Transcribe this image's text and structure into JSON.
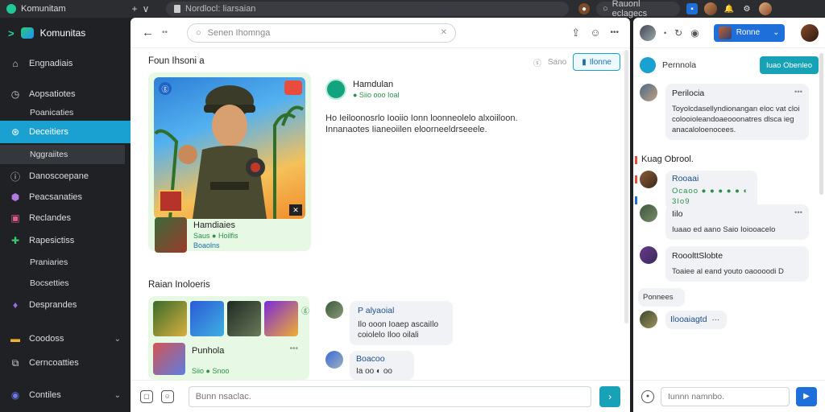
{
  "browser": {
    "tab_title": "Komunitam",
    "new_tab": "+",
    "tab_menu": "∨",
    "address": "Nordlocl: liarsaian",
    "search_box": "Rauonl eclagecs"
  },
  "sidebar": {
    "brand": "Komunitas",
    "items": [
      {
        "label": "Engnadiais"
      },
      {
        "label": "Aopsatiotes"
      },
      {
        "label": "Poanicaties"
      },
      {
        "label": "Deceitiers"
      },
      {
        "label": "Nggraiites"
      },
      {
        "label": "Danoscoepane"
      },
      {
        "label": "Peacsanaties"
      },
      {
        "label": "Reclandes"
      },
      {
        "label": "Rapesictiss"
      },
      {
        "label": "Praniaries"
      },
      {
        "label": "Bocsetties"
      },
      {
        "label": "Desprandes"
      },
      {
        "label": "Coodoss"
      },
      {
        "label": "Cerncoatties"
      },
      {
        "label": "Contiles"
      }
    ]
  },
  "main": {
    "search_placeholder": "Senen Ihomnga",
    "search_clear": "✕",
    "section_featured": "Foun Ihsoni a",
    "follow_label": "Sano",
    "follow_button": "Ilonne",
    "featured_mini": {
      "title": "Hamdiaies",
      "stats": "Saus ● Hoilfis",
      "badge": "Boaolns"
    },
    "post": {
      "author": "Hamdulan",
      "sub": "● Siio ooo Ioal",
      "body_line1": "Ho Ieiloonosrlo Iooiio Ionn loonneolelo alxoiiloon.",
      "body_line2": "Innanaotes Iianeoiilen eloorneeldrseeele."
    },
    "section_related": "Raian Inoloeris",
    "related": {
      "title": "Punhola",
      "stats": "Siio ● Snoo"
    },
    "comments": [
      {
        "name": "P alyaoial",
        "text_1": "Ilo ooon Ioaep ascaiIlo",
        "text_2": "coiolelo Iloo oilali"
      },
      {
        "name": "Boacoo",
        "text_1": "Ia oo ◐ oo"
      }
    ],
    "compose_placeholder": "Bunn nsaclac."
  },
  "chat": {
    "pill_label": "Ronne",
    "row_label": "Pernnola",
    "row_button": "Iuao Obenleo",
    "messages": [
      {
        "name": "Perilocia",
        "text_1": "Toyolcdasellyndionangan eloc vat cloi",
        "text_2": "colooioleandoaeooonatres dlsca ieg",
        "text_3": "anacaloloenocees."
      },
      {
        "name": "Rooaai",
        "text_1": "Ocaoo ● ● ● ● ● ◐ 3Io9"
      },
      {
        "name": "Iilo",
        "text_1": "Iuaao ed aano Saio Ioiooacelo"
      },
      {
        "name": "RooolttSlobte",
        "text_1": "Toaiee al eand youto oaoooodi D"
      },
      {
        "name": "Ponnees"
      },
      {
        "name": "Ilooaiagtd",
        "text_1": "···"
      }
    ],
    "label_mid": "Kuag Obrool.",
    "compose_placeholder": "Iunnn namnbo."
  }
}
